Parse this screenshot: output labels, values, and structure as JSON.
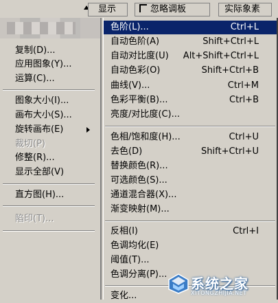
{
  "toolbar": {
    "show_label": "显示",
    "ignore_label": "忽略调板",
    "actual_pixels_label": "实际象素"
  },
  "left_menu": {
    "items": [
      {
        "label": "复制(D)...",
        "enabled": true
      },
      {
        "label": "应用图象(Y)...",
        "enabled": true
      },
      {
        "label": "运算(C)...",
        "enabled": true
      },
      {
        "label": "图象大小(I)...",
        "enabled": true
      },
      {
        "label": "画布大小(S)...",
        "enabled": true
      },
      {
        "label": "旋转画布(E)",
        "enabled": true,
        "submenu": true
      },
      {
        "label": "裁切(P)",
        "enabled": false
      },
      {
        "label": "修整(R)...",
        "enabled": true
      },
      {
        "label": "显示全部(V)",
        "enabled": true
      },
      {
        "label": "直方图(H)...",
        "enabled": true
      },
      {
        "label": "陷印(T)...",
        "enabled": false
      }
    ]
  },
  "submenu": {
    "items": [
      {
        "label": "色阶(L)...",
        "shortcut": "Ctrl+L",
        "highlighted": true
      },
      {
        "label": "自动色阶(A)",
        "shortcut": "Shift+Ctrl+L"
      },
      {
        "label": "自动对比度(U)",
        "shortcut": "Alt+Shift+Ctrl+L"
      },
      {
        "label": "自动色彩(O)",
        "shortcut": "Shift+Ctrl+B"
      },
      {
        "label": "曲线(V)...",
        "shortcut": "Ctrl+M"
      },
      {
        "label": "色彩平衡(B)...",
        "shortcut": "Ctrl+B"
      },
      {
        "label": "亮度/对比度(C)...",
        "shortcut": ""
      },
      {
        "label": "色相/饱和度(H)...",
        "shortcut": "Ctrl+U"
      },
      {
        "label": "去色(D)",
        "shortcut": "Shift+Ctrl+U"
      },
      {
        "label": "替换颜色(R)...",
        "shortcut": ""
      },
      {
        "label": "可选颜色(S)...",
        "shortcut": ""
      },
      {
        "label": "通道混合器(X)...",
        "shortcut": ""
      },
      {
        "label": "渐变映射(M)...",
        "shortcut": ""
      },
      {
        "label": "反相(I)",
        "shortcut": "Ctrl+I"
      },
      {
        "label": "色调均化(E)",
        "shortcut": ""
      },
      {
        "label": "阈值(T)...",
        "shortcut": ""
      },
      {
        "label": "色调分离(P)...",
        "shortcut": ""
      },
      {
        "label": "变化...",
        "shortcut": ""
      }
    ]
  },
  "watermark": {
    "text": "系统之家",
    "url": "XITONGZHIJIA.NET"
  },
  "colors": {
    "menu_bg": "#d4d0c8",
    "highlight": "#0a246a",
    "disabled": "#8a8a8a"
  }
}
